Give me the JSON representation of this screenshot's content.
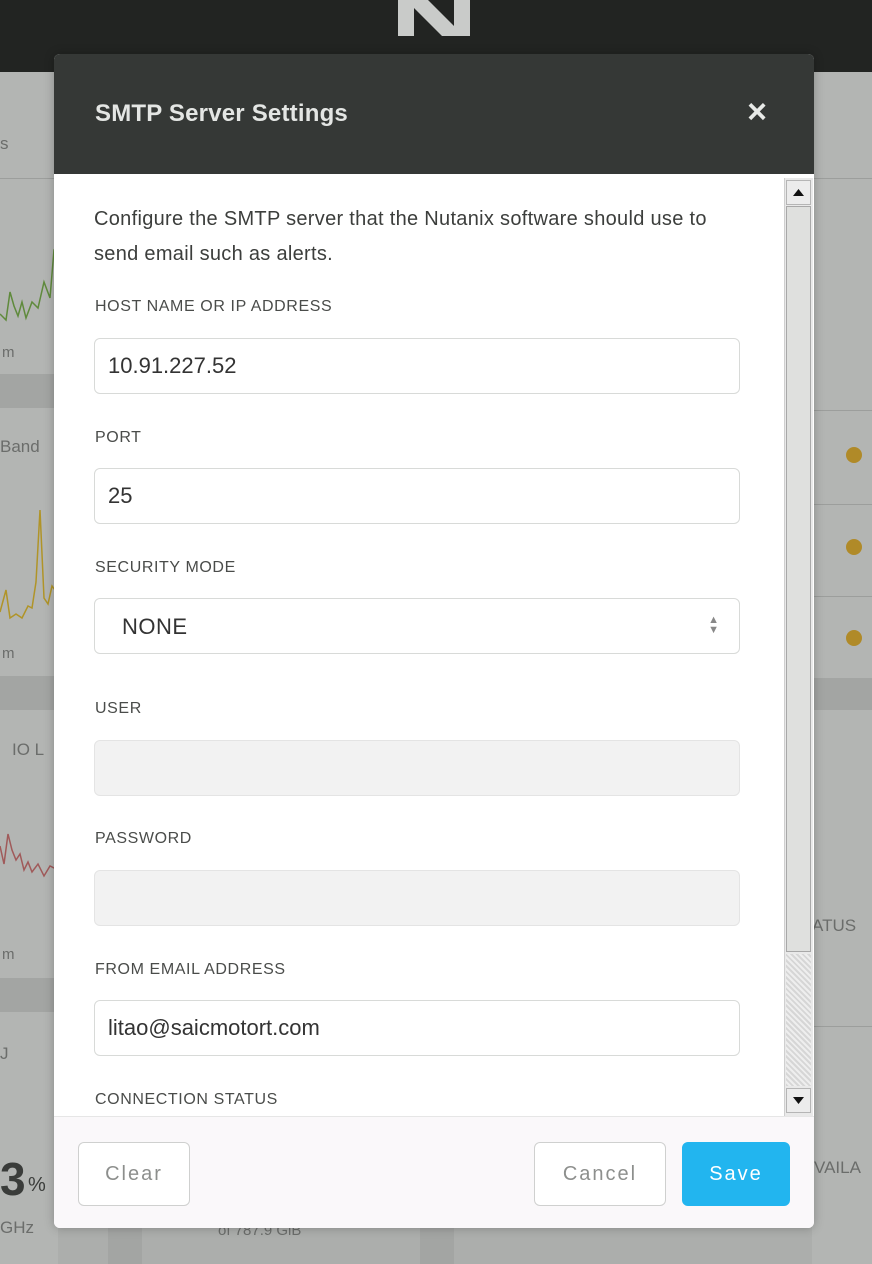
{
  "background": {
    "left_fragments": [
      "s",
      "m",
      "Band",
      "m",
      "IO L",
      "m",
      "J",
      "3",
      "%",
      "GHz"
    ],
    "right_fragments": [
      "ATUS",
      "VAILA"
    ],
    "bottom_fragment": "of 787.9 GiB"
  },
  "modal": {
    "title": "SMTP Server Settings",
    "close_icon": "×",
    "intro": "Configure the SMTP server that the Nutanix software should use to send email such as alerts.",
    "fields": {
      "host": {
        "label": "HOST NAME OR IP ADDRESS",
        "value": "10.91.227.52"
      },
      "port": {
        "label": "PORT",
        "value": "25"
      },
      "security_mode": {
        "label": "SECURITY MODE",
        "value": "NONE"
      },
      "user": {
        "label": "USER",
        "value": ""
      },
      "password": {
        "label": "PASSWORD",
        "value": ""
      },
      "from_email": {
        "label": "FROM EMAIL ADDRESS",
        "value": "litao@saicmotort.com"
      },
      "connection_status": {
        "label": "CONNECTION STATUS"
      }
    },
    "buttons": {
      "clear": "Clear",
      "cancel": "Cancel",
      "save": "Save"
    }
  },
  "colors": {
    "header_bg": "#353836",
    "save_bg": "#22b5ef",
    "status_dot": "#b08a28"
  }
}
